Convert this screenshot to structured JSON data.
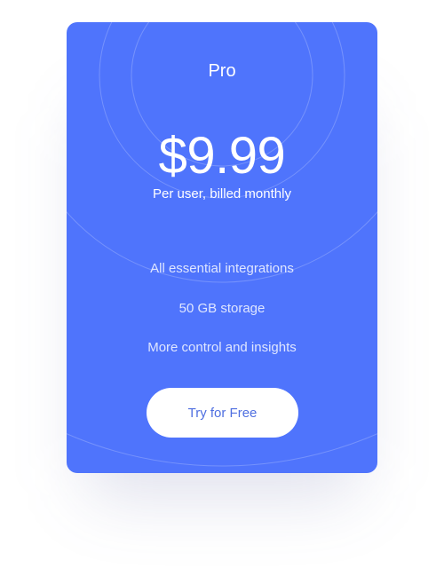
{
  "plan": {
    "name": "Pro",
    "price": "$9.99",
    "billing": "Per user, billed monthly",
    "features": [
      "All essential integrations",
      "50 GB storage",
      "More control and insights"
    ],
    "cta_label": "Try for Free"
  },
  "colors": {
    "card_background": "#4f74fc",
    "button_background": "#ffffff",
    "button_text": "#4f6fe0"
  }
}
